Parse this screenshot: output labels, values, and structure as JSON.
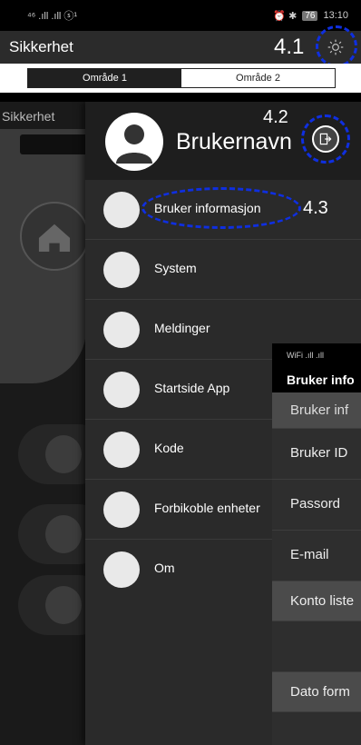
{
  "statusbar": {
    "left": "⁴⁶ .ıll .ıll ⓢ¹",
    "right_icons": "⏰ ✱",
    "battery": "76",
    "time": "13:10"
  },
  "header": {
    "title": "Sikkerhet",
    "step": "4.1"
  },
  "tabs": [
    {
      "label": "Område 1",
      "active": true
    },
    {
      "label": "Område 2",
      "active": false
    }
  ],
  "background": {
    "title": "Sikkerhet",
    "icons": [
      "home-icon",
      "door-icon",
      "door-open-icon",
      "chip-icon"
    ]
  },
  "drawer": {
    "username": "Brukernavn",
    "step_logout": "4.2",
    "step_user_info": "4.3",
    "items": [
      {
        "label": "Bruker informasjon",
        "icon": "user-icon"
      },
      {
        "label": "System",
        "icon": "door-icon"
      },
      {
        "label": "Meldinger",
        "icon": "bell-icon"
      },
      {
        "label": "Startside App",
        "icon": "star-icon"
      },
      {
        "label": "Kode",
        "icon": "keypad-lock-icon"
      },
      {
        "label": "Forbikoble enheter",
        "icon": "bypass-icon"
      },
      {
        "label": "Om",
        "icon": "info-icon"
      }
    ]
  },
  "subpanel": {
    "statusbar": "WiFi .ıll .ıll",
    "title": "Bruker info",
    "rows": [
      "Bruker inf",
      "Bruker ID",
      "Passord",
      "E-mail",
      "Konto liste",
      "",
      "Dato form"
    ]
  },
  "accent_color": "#0f2fe0"
}
